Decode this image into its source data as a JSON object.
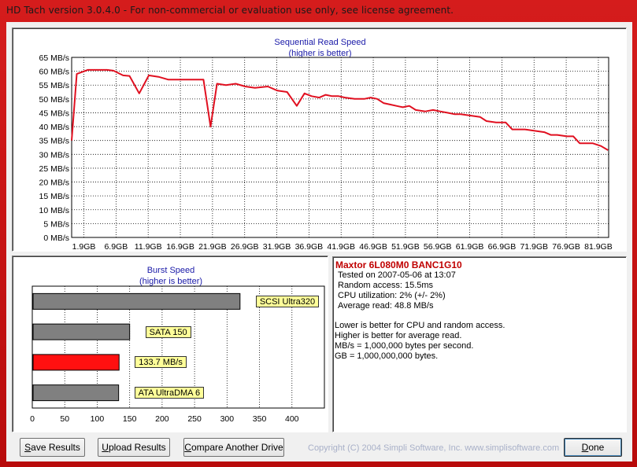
{
  "window": {
    "title": "HD Tach version 3.0.4.0  - For non-commercial or evaluation use only, see license agreement."
  },
  "colors": {
    "line": "#e01020",
    "bar": "#808080",
    "bar_highlight": "#ff1010",
    "label_bg": "#ffff99",
    "title_blue": "#1a1aa8",
    "drive_red": "#c00000"
  },
  "sequential_chart": {
    "title": "Sequential Read Speed",
    "subtitle": "(higher is better)"
  },
  "burst_chart": {
    "title": "Burst Speed",
    "subtitle": "(higher is better)"
  },
  "chart_data": [
    {
      "type": "line",
      "title": "Sequential Read Speed",
      "subtitle": "(higher is better)",
      "y_tick_labels": [
        "65 MB/s",
        "60 MB/s",
        "55 MB/s",
        "50 MB/s",
        "45 MB/s",
        "40 MB/s",
        "35 MB/s",
        "30 MB/s",
        "25 MB/s",
        "20 MB/s",
        "15 MB/s",
        "10 MB/s",
        "5 MB/s",
        "0 MB/s"
      ],
      "x_tick_labels": [
        "1.9GB",
        "6.9GB",
        "11.9GB",
        "16.9GB",
        "21.9GB",
        "26.9GB",
        "31.9GB",
        "36.9GB",
        "41.9GB",
        "46.9GB",
        "51.9GB",
        "56.9GB",
        "61.9GB",
        "66.9GB",
        "71.9GB",
        "76.9GB",
        "81.9GB"
      ],
      "xlim": [
        0,
        83.5
      ],
      "ylim": [
        0,
        65
      ],
      "grid": true,
      "series": [
        {
          "x": [
            0,
            0.8,
            2.5,
            5.5,
            6.5,
            8.0,
            9.0,
            10.5,
            12.0,
            13.5,
            15.0,
            19.0,
            20.5,
            21.6,
            22.6,
            24.0,
            25.5,
            27.0,
            28.5,
            30.5,
            32.0,
            33.5,
            35.0,
            36.2,
            37.3,
            38.5,
            39.5,
            40.5,
            41.5,
            42.5,
            44.0,
            45.5,
            46.5,
            47.5,
            48.5,
            49.5,
            50.5,
            51.5,
            52.5,
            53.5,
            55.0,
            56.2,
            57.3,
            58.5,
            59.5,
            60.5,
            62.0,
            63.5,
            64.5,
            66.0,
            67.5,
            68.5,
            69.5,
            70.5,
            72.0,
            73.5,
            74.5,
            75.5,
            77.0,
            78.0,
            79.0,
            80.0,
            81.0,
            82.3,
            83.4
          ],
          "y": [
            35.0,
            59.0,
            60.5,
            60.5,
            60.2,
            58.5,
            58.3,
            52.0,
            58.5,
            58.0,
            57.0,
            57.0,
            57.0,
            40.0,
            55.5,
            55.0,
            55.5,
            54.5,
            54.0,
            54.5,
            53.0,
            52.5,
            47.5,
            52.0,
            51.0,
            50.5,
            51.5,
            51.0,
            51.0,
            50.5,
            50.0,
            50.0,
            50.5,
            50.0,
            48.5,
            48.0,
            47.5,
            47.0,
            47.5,
            46.0,
            45.5,
            46.0,
            45.5,
            45.0,
            44.5,
            44.5,
            44.0,
            43.5,
            42.0,
            41.5,
            41.5,
            39.0,
            39.0,
            39.0,
            38.5,
            38.0,
            37.0,
            37.0,
            36.5,
            36.5,
            34.0,
            34.0,
            34.0,
            33.0,
            31.5
          ]
        }
      ]
    },
    {
      "type": "bar",
      "orientation": "horizontal",
      "title": "Burst Speed",
      "subtitle": "(higher is better)",
      "xlim": [
        0,
        450
      ],
      "x_tick_labels": [
        "0",
        "50",
        "100",
        "150",
        "200",
        "250",
        "300",
        "350",
        "400"
      ],
      "grid": true,
      "categories": [
        "SCSI Ultra320",
        "SATA 150",
        "133.7 MB/s",
        "ATA UltraDMA 6"
      ],
      "values": [
        320,
        150,
        133.7,
        133
      ],
      "highlight_index": 2
    }
  ],
  "info": {
    "drive_name": "Maxtor 6L080M0 BANC1G10",
    "tested_on": "Tested on 2007-05-06 at 13:07",
    "random_access": "Random access: 15.5ms",
    "cpu": "CPU utilization: 2% (+/- 2%)",
    "avg_read": "Average read: 48.8 MB/s",
    "note1": "Lower is better for CPU and random access.",
    "note2": "Higher is better for average read.",
    "note3": "MB/s = 1,000,000 bytes per second.",
    "note4": "GB = 1,000,000,000 bytes."
  },
  "buttons": {
    "save": {
      "u": "S",
      "rest": "ave Results"
    },
    "upload": {
      "u": "U",
      "rest": "pload Results"
    },
    "compare": {
      "u": "C",
      "rest": "ompare Another Drive"
    },
    "done": {
      "u": "D",
      "rest": "one"
    }
  },
  "copyright": "Copyright (C) 2004 Simpli Software, Inc. www.simplisoftware.com"
}
